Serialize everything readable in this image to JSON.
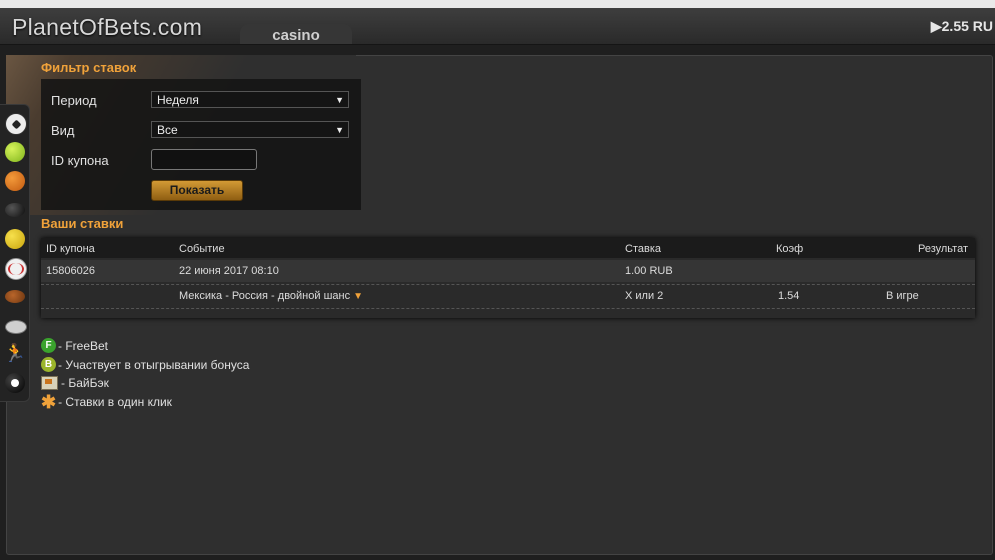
{
  "header": {
    "logo": "PlanetOfBets.com",
    "tab": "casino",
    "balance": "▶2.55 RU"
  },
  "sports_bar": {
    "icons": [
      "football-icon",
      "tennis-icon",
      "basketball-icon",
      "hockey-icon",
      "badminton-icon",
      "baseball-icon",
      "american-football-icon",
      "rugby-icon",
      "athletics-icon",
      "billiard-icon"
    ]
  },
  "filter": {
    "title": "Фильтр ставок",
    "period_label": "Период",
    "period_value": "Неделя",
    "type_label": "Вид",
    "type_value": "Все",
    "coupon_label": "ID купона",
    "coupon_value": "",
    "show_button": "Показать"
  },
  "bets": {
    "title": "Ваши ставки",
    "columns": [
      "ID купона",
      "Событие",
      "Ставка",
      "Коэф",
      "Результат"
    ],
    "rows": [
      {
        "id": "15806026",
        "event": "22 июня 2017 08:10",
        "stake": "1.00 RUB",
        "coef": "",
        "result": ""
      },
      {
        "id": "",
        "event": "Мексика - Россия - двойной шанс",
        "stake": "Х или 2",
        "coef": "1.54",
        "result": "В игре"
      }
    ]
  },
  "legend": {
    "freebet_letter": "F",
    "freebet": "- FreeBet",
    "bonus_letter": "B",
    "bonus": "- Участвует в отыгрывании бонуса",
    "buyback": "- БайБэк",
    "oneclick_symbol": "✱",
    "oneclick": "- Ставки в один клик"
  },
  "colors": {
    "accent": "#f0a23a",
    "background": "#1f1f1f",
    "panel": "#2f2f2f"
  }
}
